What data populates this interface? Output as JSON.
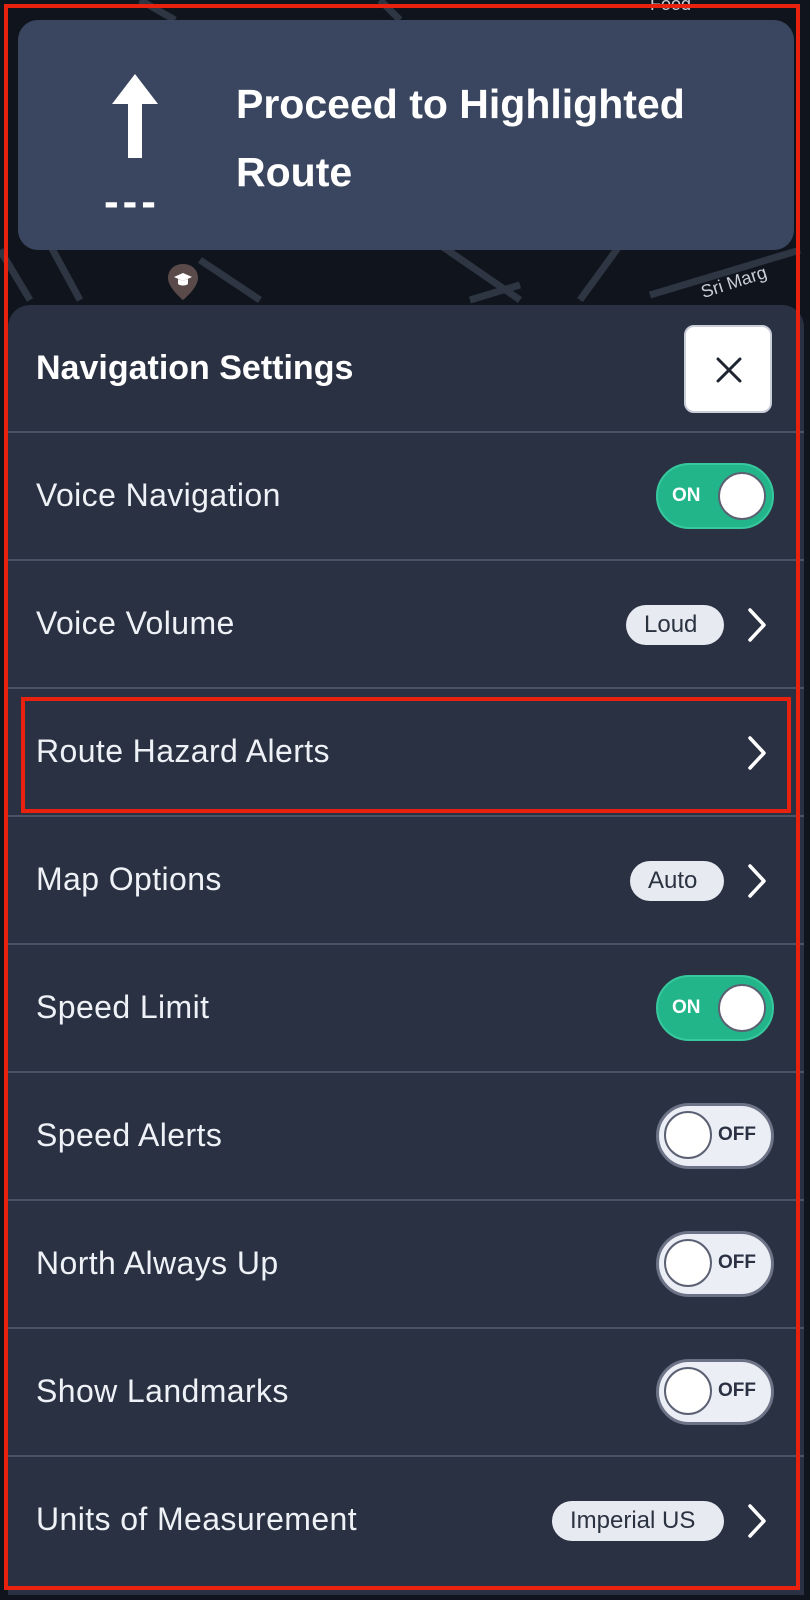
{
  "map": {
    "labels": [
      "Food",
      "Sri Marg"
    ]
  },
  "banner": {
    "instruction": "Proceed to Highlighted Route",
    "distance": "---",
    "direction_icon": "straight-arrow-icon"
  },
  "panel": {
    "title": "Navigation Settings",
    "close_icon": "close-icon",
    "rows": [
      {
        "label": "Voice Navigation",
        "control": "toggle",
        "state": "ON"
      },
      {
        "label": "Voice Volume",
        "control": "badge",
        "value": "Loud"
      },
      {
        "label": "Route Hazard Alerts",
        "control": "chevron",
        "highlighted": true
      },
      {
        "label": "Map Options",
        "control": "badge",
        "value": "Auto"
      },
      {
        "label": "Speed Limit",
        "control": "toggle",
        "state": "ON"
      },
      {
        "label": "Speed Alerts",
        "control": "toggle",
        "state": "OFF"
      },
      {
        "label": "North Always Up",
        "control": "toggle",
        "state": "OFF"
      },
      {
        "label": "Show Landmarks",
        "control": "toggle",
        "state": "OFF"
      },
      {
        "label": "Units of Measurement",
        "control": "badge",
        "value": "Imperial US"
      }
    ]
  },
  "colors": {
    "toggle_on": "#23b58a",
    "panel_bg": "#2a3142",
    "banner_bg": "#3a4660",
    "highlight": "#e8220f"
  }
}
